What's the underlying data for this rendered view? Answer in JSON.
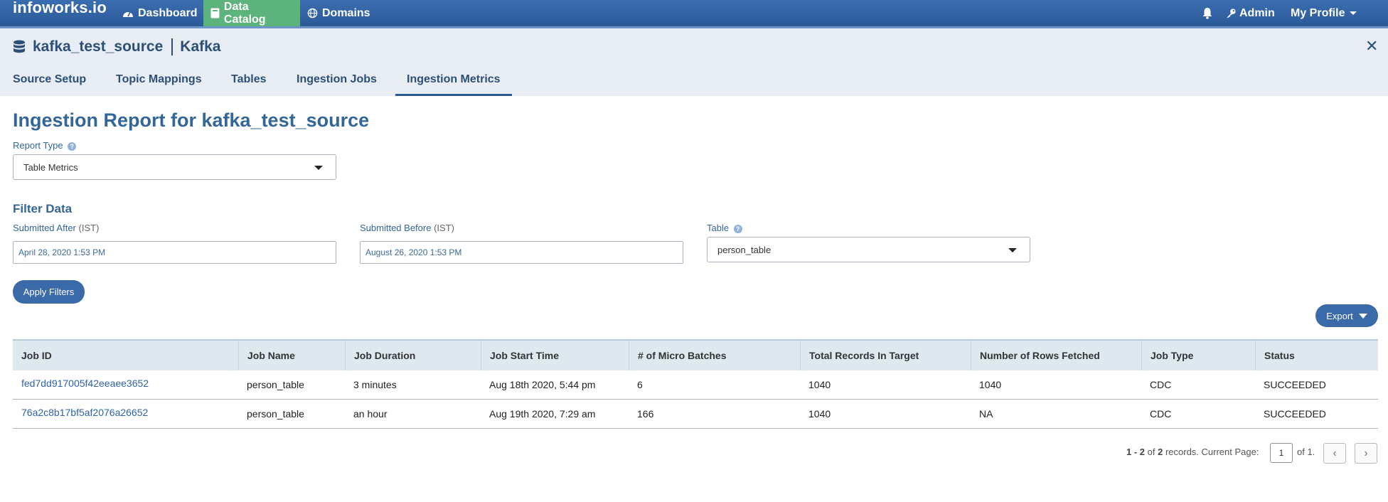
{
  "topnav": {
    "brand": "infoworks.io",
    "items": [
      {
        "label": "Dashboard",
        "icon": "dashboard-gauge-icon"
      },
      {
        "label": "Data Catalog",
        "icon": "book-icon",
        "active": true
      },
      {
        "label": "Domains",
        "icon": "globe-icon"
      }
    ],
    "admin_label": "Admin",
    "profile_label": "My Profile"
  },
  "source": {
    "name": "kafka_test_source",
    "type": "Kafka"
  },
  "tabs": [
    {
      "label": "Source Setup"
    },
    {
      "label": "Topic Mappings"
    },
    {
      "label": "Tables"
    },
    {
      "label": "Ingestion Jobs"
    },
    {
      "label": "Ingestion Metrics",
      "active": true
    }
  ],
  "report": {
    "title": "Ingestion Report for kafka_test_source",
    "report_type_label": "Report Type",
    "report_type_value": "Table Metrics"
  },
  "filter": {
    "title": "Filter Data",
    "submitted_after_label": "Submitted After",
    "submitted_after_tz": "(IST)",
    "submitted_after_value": "April 28, 2020 1:53 PM",
    "submitted_before_label": "Submitted Before",
    "submitted_before_tz": "(IST)",
    "submitted_before_value": "August 26, 2020 1:53 PM",
    "table_label": "Table",
    "table_value": "person_table",
    "apply_label": "Apply Filters"
  },
  "export_label": "Export",
  "table": {
    "columns": [
      "Job ID",
      "Job Name",
      "Job Duration",
      "Job Start Time",
      "# of Micro Batches",
      "Total Records In Target",
      "Number of Rows Fetched",
      "Job Type",
      "Status"
    ],
    "rows": [
      [
        "fed7dd917005f42eeaee3652",
        "person_table",
        "3 minutes",
        "Aug 18th 2020, 5:44 pm",
        "6",
        "1040",
        "1040",
        "CDC",
        "SUCCEEDED"
      ],
      [
        "76a2c8b17bf5af2076a26652",
        "person_table",
        "an hour",
        "Aug 19th 2020, 7:29 am",
        "166",
        "1040",
        "NA",
        "CDC",
        "SUCCEEDED"
      ]
    ]
  },
  "pagination": {
    "range_start": "1",
    "range_sep": " - ",
    "range_end": "2",
    "of": " of ",
    "total": "2",
    "records_text": " records. Current Page:",
    "current_page": "1",
    "of_pages": "of 1."
  },
  "colors": {
    "nav_blue": "#2c5a99",
    "active_green": "#5cb37b",
    "title_blue": "#336699",
    "header_bg": "#e8edf3",
    "table_head_bg": "#dde9ef"
  }
}
